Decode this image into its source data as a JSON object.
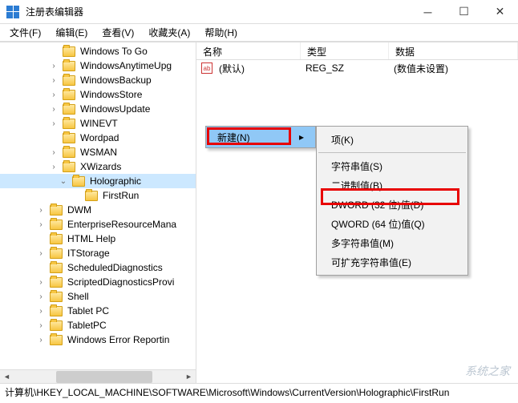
{
  "window": {
    "title": "注册表编辑器"
  },
  "menus": {
    "file": "文件(F)",
    "edit": "编辑(E)",
    "view": "查看(V)",
    "fav": "收藏夹(A)",
    "help": "帮助(H)"
  },
  "tree": {
    "items": [
      {
        "label": "Windows To Go",
        "exp": null,
        "ind": 0
      },
      {
        "label": "WindowsAnytimeUpg",
        "exp": "c",
        "ind": 0
      },
      {
        "label": "WindowsBackup",
        "exp": "c",
        "ind": 0
      },
      {
        "label": "WindowsStore",
        "exp": "c",
        "ind": 0
      },
      {
        "label": "WindowsUpdate",
        "exp": "c",
        "ind": 0
      },
      {
        "label": "WINEVT",
        "exp": "c",
        "ind": 0
      },
      {
        "label": "Wordpad",
        "exp": null,
        "ind": 0
      },
      {
        "label": "WSMAN",
        "exp": "c",
        "ind": 0
      },
      {
        "label": "XWizards",
        "exp": "c",
        "ind": 0
      },
      {
        "label": "Holographic",
        "exp": "e",
        "ind": 1,
        "sel": true
      },
      {
        "label": "FirstRun",
        "exp": null,
        "ind": 2
      },
      {
        "label": "DWM",
        "exp": "c",
        "ind": "b"
      },
      {
        "label": "EnterpriseResourceMana",
        "exp": "c",
        "ind": "b"
      },
      {
        "label": "HTML Help",
        "exp": null,
        "ind": "b"
      },
      {
        "label": "ITStorage",
        "exp": "c",
        "ind": "b"
      },
      {
        "label": "ScheduledDiagnostics",
        "exp": null,
        "ind": "b"
      },
      {
        "label": "ScriptedDiagnosticsProvi",
        "exp": "c",
        "ind": "b"
      },
      {
        "label": "Shell",
        "exp": "c",
        "ind": "b"
      },
      {
        "label": "Tablet PC",
        "exp": "c",
        "ind": "b"
      },
      {
        "label": "TabletPC",
        "exp": "c",
        "ind": "b"
      },
      {
        "label": "Windows Error Reportin",
        "exp": "c",
        "ind": "b"
      }
    ]
  },
  "list": {
    "cols": {
      "name": "名称",
      "type": "类型",
      "data": "数据"
    },
    "rows": [
      {
        "name": "(默认)",
        "type": "REG_SZ",
        "data": "(数值未设置)"
      }
    ]
  },
  "context": {
    "new": "新建(N)",
    "sub": {
      "key": "项(K)",
      "string": "字符串值(S)",
      "binary": "二进制值(B)",
      "dword": "DWORD (32 位)值(D)",
      "qword": "QWORD (64 位)值(Q)",
      "multi": "多字符串值(M)",
      "expand": "可扩充字符串值(E)"
    }
  },
  "statusbar": {
    "path": "计算机\\HKEY_LOCAL_MACHINE\\SOFTWARE\\Microsoft\\Windows\\CurrentVersion\\Holographic\\FirstRun"
  },
  "watermark": "系统之家"
}
